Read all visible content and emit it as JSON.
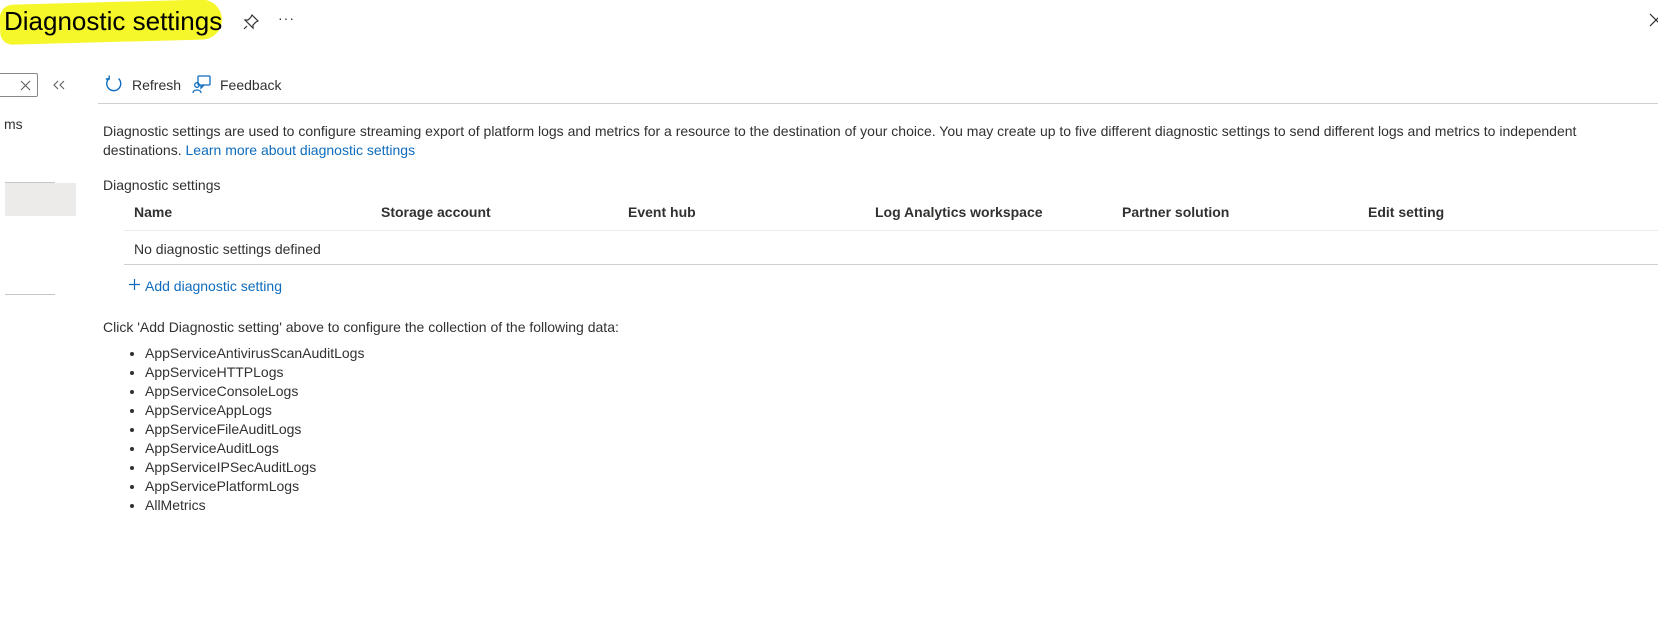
{
  "header": {
    "title": "Diagnostic settings",
    "more_label": "···"
  },
  "rail": {
    "item_label": "ms"
  },
  "toolbar": {
    "refresh_label": "Refresh",
    "feedback_label": "Feedback"
  },
  "description": {
    "line1": "Diagnostic settings are used to configure streaming export of platform logs and metrics for a resource to the destination of your choice. You may create up to five different diagnostic settings to send different logs and metrics to independent",
    "line2_prefix": "destinations. ",
    "link": "Learn more about diagnostic settings"
  },
  "settings": {
    "label": "Diagnostic settings",
    "columns": [
      "Name",
      "Storage account",
      "Event hub",
      "Log Analytics workspace",
      "Partner solution",
      "Edit setting"
    ],
    "empty_text": "No diagnostic settings defined",
    "add_label": "Add diagnostic setting"
  },
  "collection": {
    "hint": "Click 'Add Diagnostic setting' above to configure the collection of the following data:",
    "items": [
      "AppServiceAntivirusScanAuditLogs",
      "AppServiceHTTPLogs",
      "AppServiceConsoleLogs",
      "AppServiceAppLogs",
      "AppServiceFileAuditLogs",
      "AppServiceAuditLogs",
      "AppServiceIPSecAuditLogs",
      "AppServicePlatformLogs",
      "AllMetrics"
    ]
  },
  "colors": {
    "accent": "#0f6cbd",
    "highlight": "#f6f72a"
  }
}
